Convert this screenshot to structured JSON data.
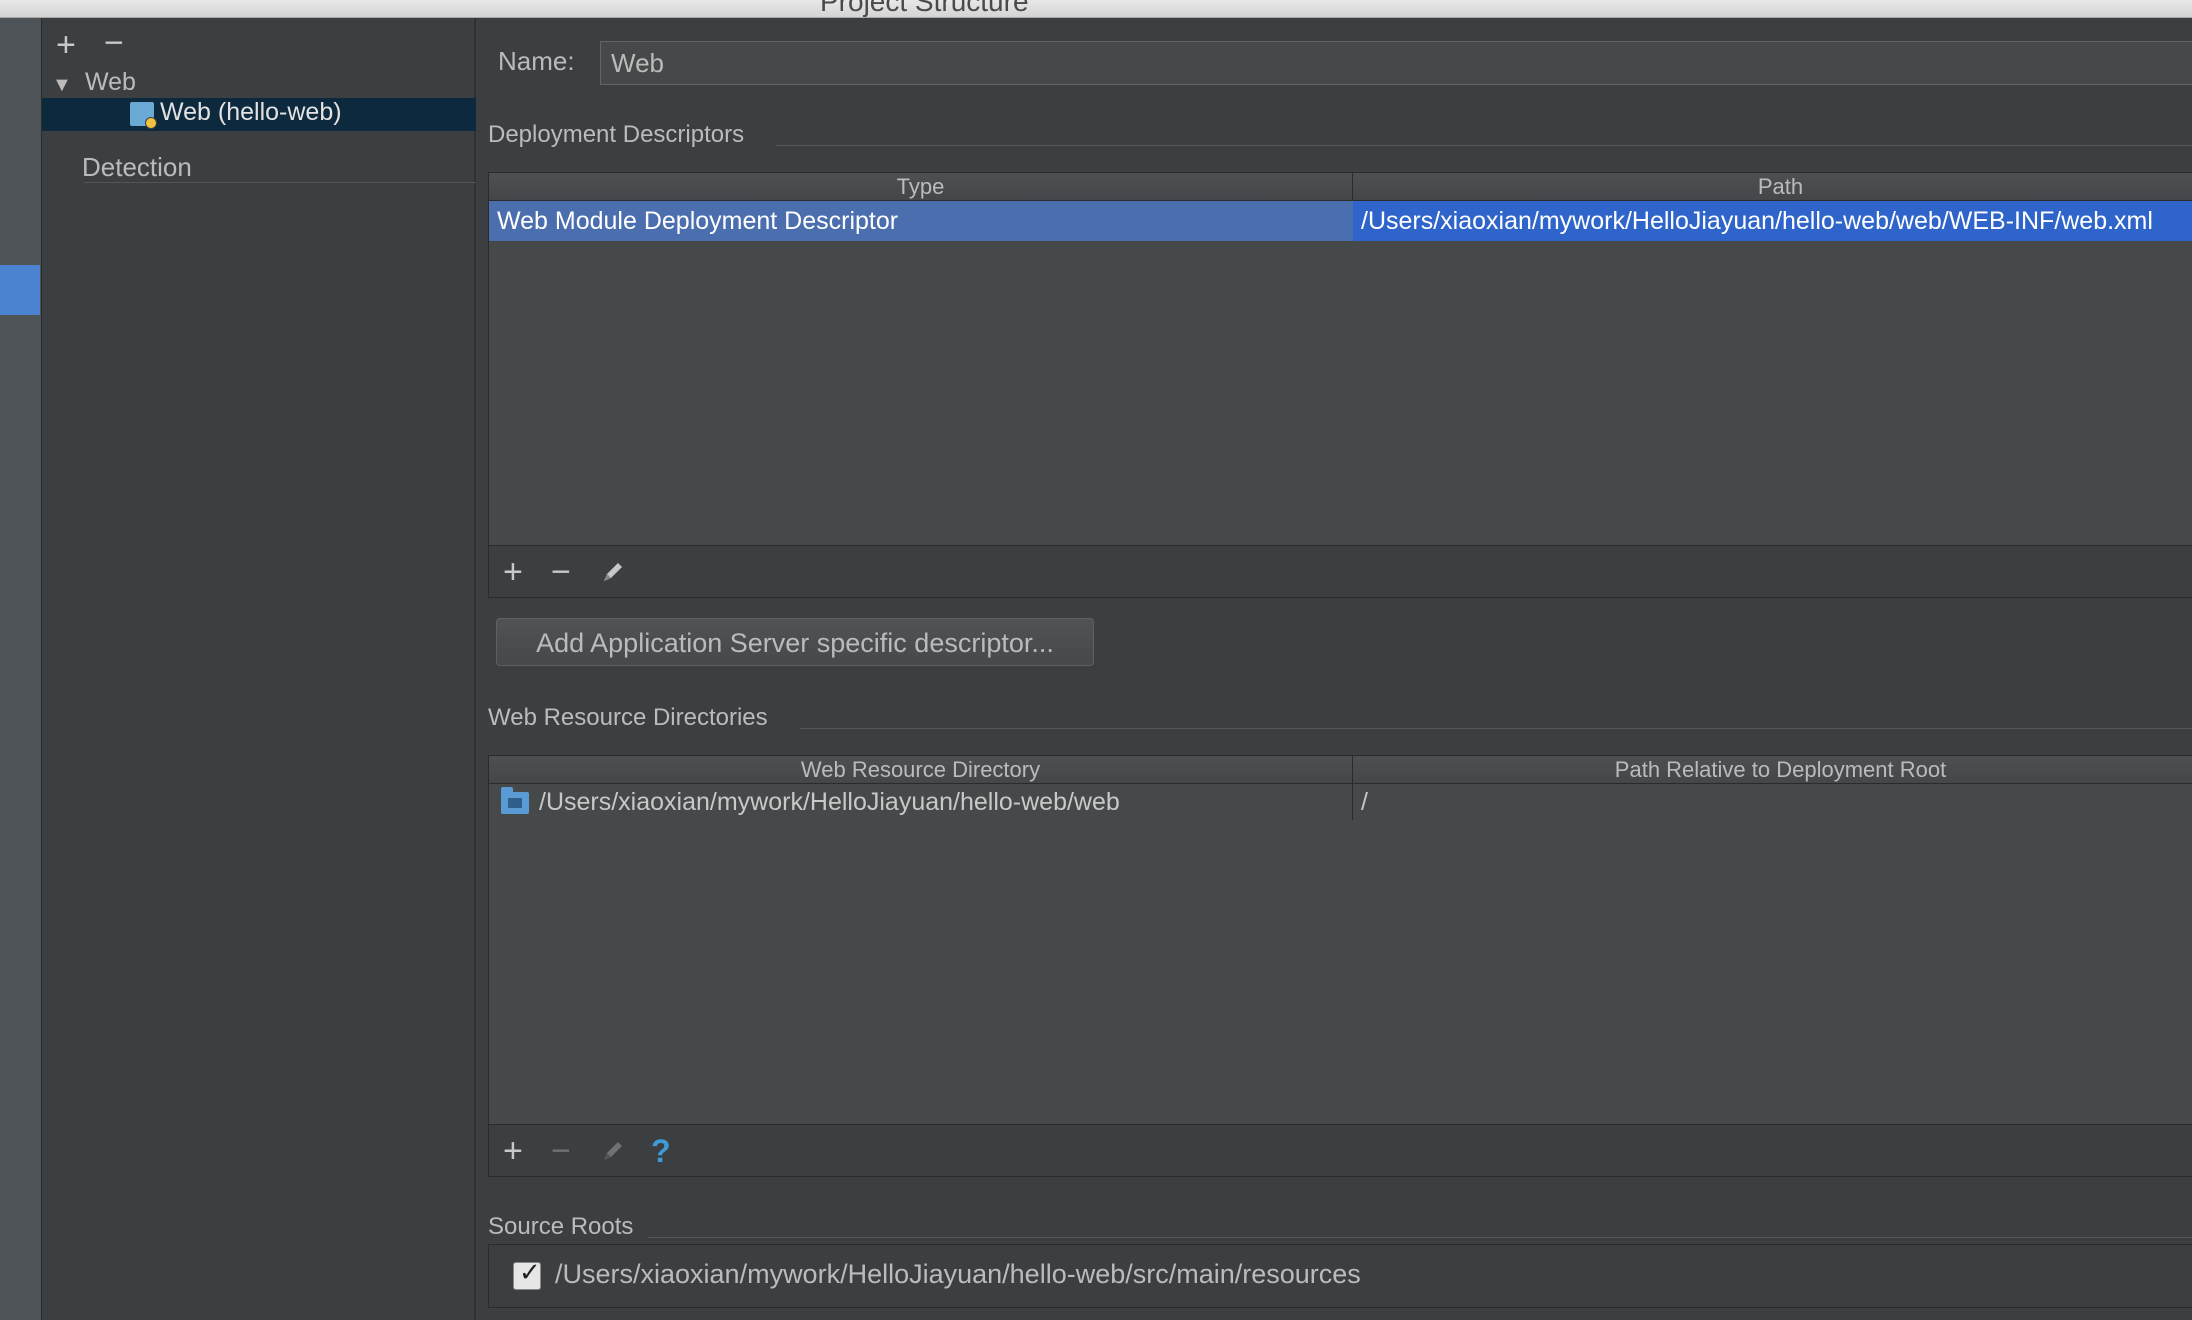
{
  "window": {
    "title": "Project Structure"
  },
  "tree": {
    "add_icon": "plus-icon",
    "remove_icon": "minus-icon",
    "root_label": "Web",
    "selected_item": "Web (hello-web)",
    "detection_label": "Detection"
  },
  "name_field": {
    "label": "Name:",
    "value": "Web"
  },
  "deployment_descriptors": {
    "title": "Deployment Descriptors",
    "columns": [
      "Type",
      "Path"
    ],
    "rows": [
      {
        "type": "Web Module Deployment Descriptor",
        "path": "/Users/xiaoxian/mywork/HelloJiayuan/hello-web/web/WEB-INF/web.xml"
      }
    ],
    "toolbar": {
      "add": "+",
      "remove": "−"
    },
    "add_server_button": "Add Application Server specific descriptor..."
  },
  "web_resource_directories": {
    "title": "Web Resource Directories",
    "columns": [
      "Web Resource Directory",
      "Path Relative to Deployment Root"
    ],
    "rows": [
      {
        "directory": "/Users/xiaoxian/mywork/HelloJiayuan/hello-web/web",
        "relative": "/"
      }
    ],
    "toolbar": {
      "add": "+",
      "remove": "−",
      "help": "?"
    }
  },
  "source_roots": {
    "title": "Source Roots",
    "items": [
      {
        "checked": true,
        "path": "/Users/xiaoxian/mywork/HelloJiayuan/hello-web/src/main/resources"
      }
    ]
  },
  "colors": {
    "background": "#3c3f41",
    "selection_focused": "#2f65ca",
    "selection_tree": "#0d293e",
    "accent": "#4b83d0"
  }
}
